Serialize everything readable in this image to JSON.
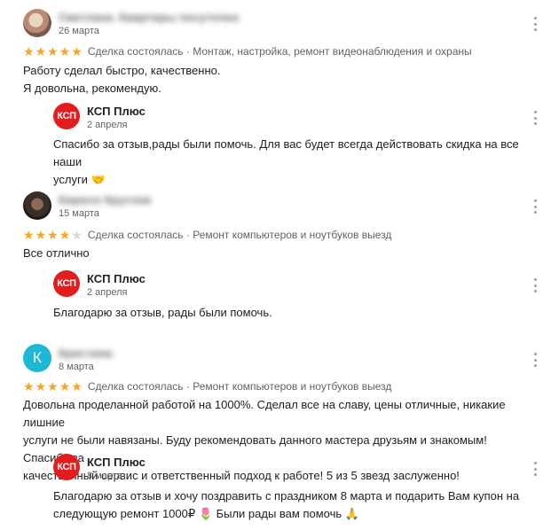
{
  "reviews": [
    {
      "author": "Светлана. Квартиры посуточно",
      "date": "26 марта",
      "stars": 5,
      "rating_text": "Сделка состоялась · Монтаж, настройка, ремонт видеонаблюдения и охраны",
      "text_lines": [
        "Работу сделал быстро, качественно.",
        "Я довольна, рекомендую."
      ],
      "avatar": "photo-avatar",
      "reply": {
        "logo_text": "КСП",
        "name": "КСП Плюс",
        "date": "2 апреля",
        "text_lines": [
          "Спасибо за отзыв,рады были помочь. Для вас будет всегда действовать скидка на все наши",
          "услуги"
        ],
        "emoji": "🤝"
      }
    },
    {
      "author": "Кирилл Круглов",
      "date": "15 марта",
      "stars": 4,
      "rating_text": "Сделка состоялась · Ремонт компьютеров и ноутбуков выезд",
      "text_lines": [
        "Все отлично"
      ],
      "avatar": "photo-avatar",
      "reply": {
        "logo_text": "КСП",
        "name": "КСП Плюс",
        "date": "2 апреля",
        "text_lines": [
          "Благодарю за отзыв, рады были помочь."
        ]
      }
    },
    {
      "author": "Кристина",
      "date": "8 марта",
      "stars": 5,
      "avatar_letter": "К",
      "rating_text": "Сделка состоялась · Ремонт компьютеров и ноутбуков выезд",
      "text_lines": [
        "Довольна проделанной работой на 1000%. Сделал все на славу, цены отличные, никакие лишние",
        "услуги не были навязаны. Буду рекомендовать данного мастера друзьям и знакомым! Спасибо за",
        "качественный сервис и ответственный подход к работе! 5 из 5 звезд заслуженно!"
      ],
      "reply": {
        "logo_text": "КСП",
        "name": "КСП Плюс",
        "date": "8 марта",
        "text_lines": [
          "Благодарю за отзыв и хочу поздравить с праздником 8 марта и подарить Вам купон на",
          "следующую ремонт 1000₽"
        ],
        "emoji_mid": "🌷",
        "text_tail": "Были рады вам помочь",
        "emoji": "🙏"
      }
    }
  ],
  "colors": {
    "star": "#f5a623",
    "star_off": "#d7d7d7",
    "logo": "#e31d1d",
    "letter_avatar": "#1fb7d6"
  },
  "icons": {
    "menu": "more-vertical-icon",
    "star": "star-icon"
  }
}
